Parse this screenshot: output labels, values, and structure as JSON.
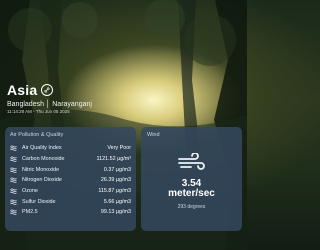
{
  "city": "Asia",
  "location": "Bangladesh │ Narayanganj",
  "timestamp": "11:14:28 AM - Thu Jun 05 2025",
  "air_quality": {
    "title": "Air Pollution & Quality",
    "rows": [
      {
        "label": "Air Quality Index",
        "value": "Very Poor"
      },
      {
        "label": "Carbon Monoxide",
        "value": "1121.52 µg/m³"
      },
      {
        "label": "Nitric Monoxide",
        "value": "0.37 µg/m3"
      },
      {
        "label": "Nitrogen Dioxide",
        "value": "26.39 µg/m3"
      },
      {
        "label": "Ozone",
        "value": "115.87 µg/m3"
      },
      {
        "label": "Sulfur Dioxide",
        "value": "5.66 µg/m3"
      },
      {
        "label": "PM2.5",
        "value": "99.13 µg/m3"
      }
    ],
    "row_icon": "smoke-icon"
  },
  "wind": {
    "title": "Wind",
    "speed": "3.54",
    "unit": "meter/sec",
    "direction": "293 degrees",
    "icon": "wind-icon"
  },
  "colors": {
    "card_bg": "#344860",
    "text": "#ffffff",
    "muted": "#c9d4e2"
  }
}
